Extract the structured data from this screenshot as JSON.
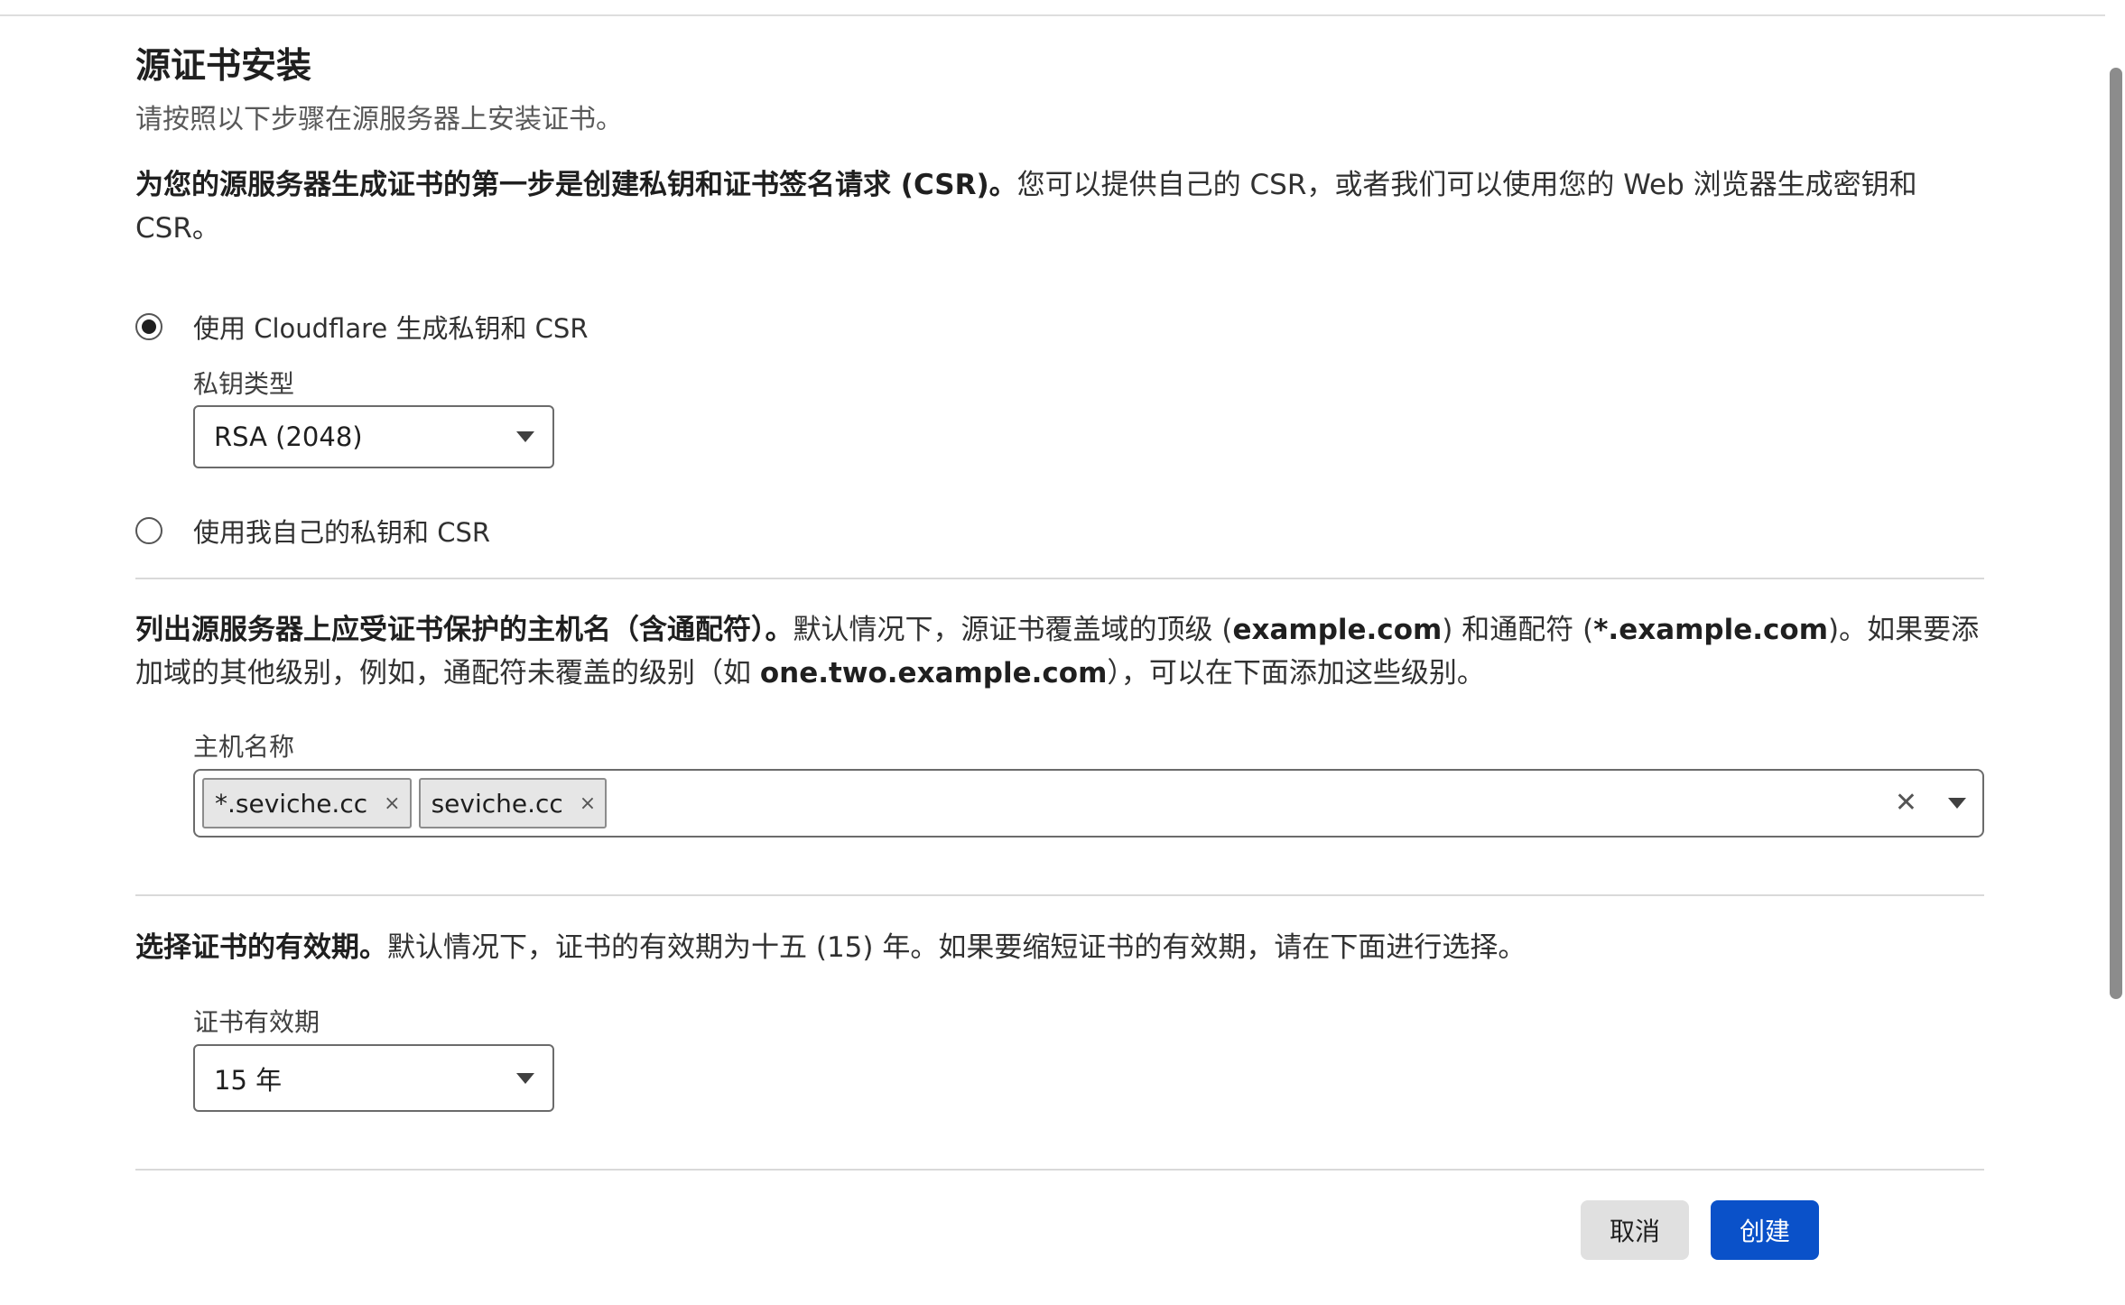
{
  "header": {
    "title": "源证书安装",
    "subtitle": "请按照以下步骤在源服务器上安装证书。"
  },
  "csr_section": {
    "intro_bold": "为您的源服务器生成证书的第一步是创建私钥和证书签名请求 (CSR)。",
    "intro_rest": "您可以提供自己的 CSR，或者我们可以使用您的 Web 浏览器生成密钥和 CSR。",
    "option_cloudflare": "使用 Cloudflare 生成私钥和 CSR",
    "key_type_label": "私钥类型",
    "key_type_value": "RSA (2048)",
    "option_own": "使用我自己的私钥和 CSR"
  },
  "hostname_section": {
    "intro_bold": "列出源服务器上应受证书保护的主机名（含通配符）。",
    "intro_1": "默认情况下，源证书覆盖域的顶级 (",
    "example_apex": "example.com",
    "intro_2": ") 和通配符 (",
    "example_wildcard": "*.example.com",
    "intro_3": ")。如果要添加域的其他级别，例如，通配符未覆盖的级别（如 ",
    "example_sub": "one.two.example.com",
    "intro_4": "），可以在下面添加这些级别。",
    "field_label": "主机名称",
    "tags": [
      "*.seviche.cc",
      "seviche.cc"
    ],
    "tag_remove_glyph": "×",
    "clear_glyph": "✕"
  },
  "validity_section": {
    "intro_bold": "选择证书的有效期。",
    "intro_rest": "默认情况下，证书的有效期为十五 (15) 年。如果要缩短证书的有效期，请在下面进行选择。",
    "field_label": "证书有效期",
    "value": "15 年"
  },
  "actions": {
    "cancel_label": "取消",
    "create_label": "创建"
  },
  "colors": {
    "primary": "#0a51c9",
    "secondary_button": "#e0e0e0",
    "divider": "#d9d9d9"
  }
}
